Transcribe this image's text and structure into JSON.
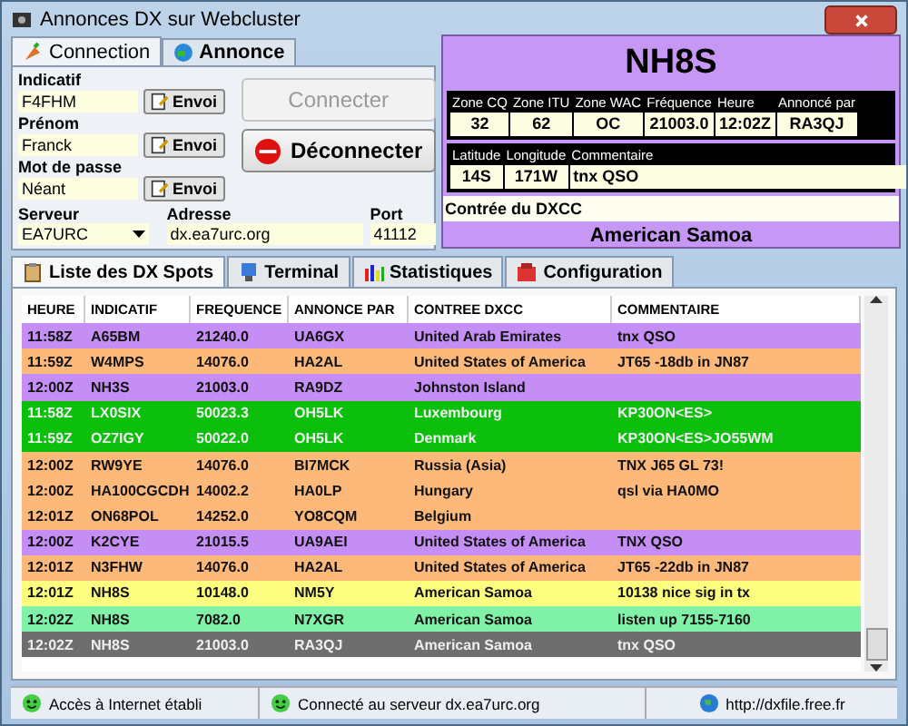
{
  "window": {
    "title": "Annonces DX sur Webcluster"
  },
  "connection_tabs": [
    {
      "label": "Connection",
      "selected": true
    },
    {
      "label": "Annonce",
      "selected": false
    }
  ],
  "fields": [
    {
      "label": "Indicatif",
      "value": "F4FHM",
      "button": "Envoi"
    },
    {
      "label": "Prénom",
      "value": "Franck",
      "button": "Envoi"
    },
    {
      "label": "Mot de passe",
      "value": "Néant",
      "button": "Envoi"
    }
  ],
  "connect_buttons": [
    {
      "kind": "connect",
      "label": "Connecter",
      "disabled": true
    },
    {
      "kind": "disconnect",
      "label": "Déconnecter",
      "disabled": false
    }
  ],
  "server": {
    "label": "Serveur",
    "value": "EA7URC"
  },
  "address": {
    "label": "Adresse",
    "value": "dx.ea7urc.org"
  },
  "port": {
    "label": "Port",
    "value": "41112"
  },
  "spot": {
    "callsign": "NH8S",
    "info_1": [
      {
        "label": "Zone CQ",
        "value": "32"
      },
      {
        "label": "Zone ITU",
        "value": "62"
      },
      {
        "label": "Zone WAC",
        "value": "OC"
      },
      {
        "label": "Fréquence",
        "value": "21003.0"
      },
      {
        "label": "Heure",
        "value": "12:02Z"
      },
      {
        "label": "Annoncé par",
        "value": "RA3QJ"
      }
    ],
    "info_2": [
      {
        "label": "Latitude",
        "value": "14S"
      },
      {
        "label": "Longitude",
        "value": "171W"
      },
      {
        "label": "Commentaire",
        "value": "tnx QSO"
      }
    ],
    "dxcc_label": "Contrée du DXCC",
    "dxcc": "American Samoa"
  },
  "list_tabs": [
    {
      "label": "Liste des DX Spots",
      "selected": true
    },
    {
      "label": "Terminal",
      "selected": false
    },
    {
      "label": "Statistiques",
      "selected": false
    },
    {
      "label": "Configuration",
      "selected": false
    }
  ],
  "table": {
    "columns": [
      "HEURE",
      "INDICATIF",
      "FREQUENCE",
      "ANNONCE PAR",
      "CONTREE DXCC",
      "COMMENTAIRE"
    ],
    "rows": [
      {
        "color": "#c58ef5",
        "cells": [
          "11:58Z",
          "A65BM",
          "21240.0",
          "UA6GX",
          "United Arab Emirates",
          "tnx QSO"
        ]
      },
      {
        "color": "#fdb97a",
        "cells": [
          "11:59Z",
          "W4MPS",
          "14076.0",
          "HA2AL",
          "United States of America",
          "JT65 -18db in JN87"
        ]
      },
      {
        "color": "#c58ef5",
        "cells": [
          "12:00Z",
          "NH3S",
          "21003.0",
          "RA9DZ",
          "Johnston Island",
          ""
        ]
      },
      {
        "color": "#0dbf0d",
        "cells": [
          "11:58Z",
          "LX0SIX",
          "50023.3",
          "OH5LK",
          "Luxembourg",
          "KP30ON<ES>"
        ]
      },
      {
        "color": "#0dbf0d",
        "cells": [
          "11:59Z",
          "OZ7IGY",
          "50022.0",
          "OH5LK",
          "Denmark",
          "KP30ON<ES>JO55WM"
        ]
      },
      {
        "color": "#fdb97a",
        "cells": [
          "12:00Z",
          "RW9YE",
          "14076.0",
          "BI7MCK",
          "Russia (Asia)",
          "TNX J65 GL 73!"
        ]
      },
      {
        "color": "#fdb97a",
        "cells": [
          "12:00Z",
          "HA100CGCDH",
          "14002.2",
          "HA0LP",
          "Hungary",
          "qsl via HA0MO"
        ]
      },
      {
        "color": "#fdb97a",
        "cells": [
          "12:01Z",
          "ON68POL",
          "14252.0",
          "YO8CQM",
          "Belgium",
          ""
        ]
      },
      {
        "color": "#c58ef5",
        "cells": [
          "12:00Z",
          "K2CYE",
          "21015.5",
          "UA9AEI",
          "United States of America",
          "TNX  QSO"
        ]
      },
      {
        "color": "#fdb97a",
        "cells": [
          "12:01Z",
          "N3FHW",
          "14076.0",
          "HA2AL",
          "United States of America",
          "JT65 -22db in JN87"
        ]
      },
      {
        "color": "#fdfd80",
        "cells": [
          "12:01Z",
          "NH8S",
          "10148.0",
          "NM5Y",
          "American Samoa",
          "10138  nice sig in tx"
        ]
      },
      {
        "color": "#80f2a8",
        "cells": [
          "12:02Z",
          "NH8S",
          "7082.0",
          "N7XGR",
          "American Samoa",
          "listen up  7155-7160"
        ]
      },
      {
        "color": "#6e6e6e",
        "cells": [
          "12:02Z",
          "NH8S",
          "21003.0",
          "RA3QJ",
          "American Samoa",
          "tnx QSO"
        ]
      }
    ]
  },
  "status_bar": [
    {
      "text": "Accès à Internet établi",
      "kind": "ok"
    },
    {
      "text": "Connecté au serveur dx.ea7urc.org",
      "kind": "ok"
    },
    {
      "text": "http://dxfile.free.fr",
      "kind": "web"
    }
  ]
}
